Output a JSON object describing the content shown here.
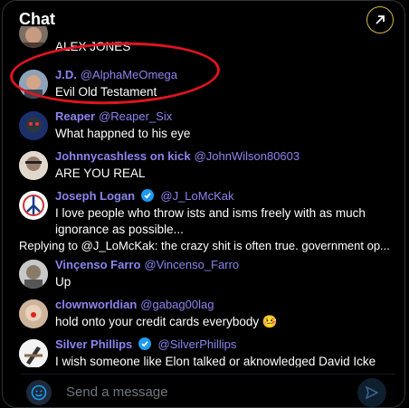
{
  "header": {
    "title": "Chat"
  },
  "messages": [
    {
      "name": "",
      "handle": "",
      "text": "ALEX JONES",
      "verified": false
    },
    {
      "name": "J.D.",
      "handle": "@AlphaMeOmega",
      "text": "Evil Old Testament",
      "verified": false
    },
    {
      "name": "Reaper",
      "handle": "@Reaper_Six",
      "text": "What happned to his eye",
      "verified": false
    },
    {
      "name": "Johnnycashless on kick",
      "handle": "@JohnWilson80603",
      "text": "ARE YOU REAL",
      "verified": false
    },
    {
      "name": "Joseph Logan",
      "handle": "@J_LoMcKak",
      "text": "I love people who throw ists and isms freely with as much ignorance as possible...",
      "verified": true
    },
    {
      "name": "Vinçenso Farro",
      "handle": "@Vincenso_Farro",
      "text": "Up",
      "verified": false
    },
    {
      "name": "clownworldian",
      "handle": "@gabag00lag",
      "text": "hold onto your credit cards everybody 🤒",
      "verified": false
    },
    {
      "name": "Silver Phillips",
      "handle": "@SilverPhillips",
      "text": "I wish someone like Elon talked or aknowledged David Icke",
      "verified": true
    }
  ],
  "reply_banner": "Replying to @J_LoMcKak: the crazy shit is often true. government op...",
  "composer": {
    "placeholder": "Send a message"
  },
  "colors": {
    "accent": "#8b84f0",
    "highlight": "#e0141e",
    "verified": "#1d9bf0"
  },
  "icons": {
    "popout": "arrow-up-right-icon",
    "emoji": "smiley-icon",
    "send": "send-icon"
  }
}
